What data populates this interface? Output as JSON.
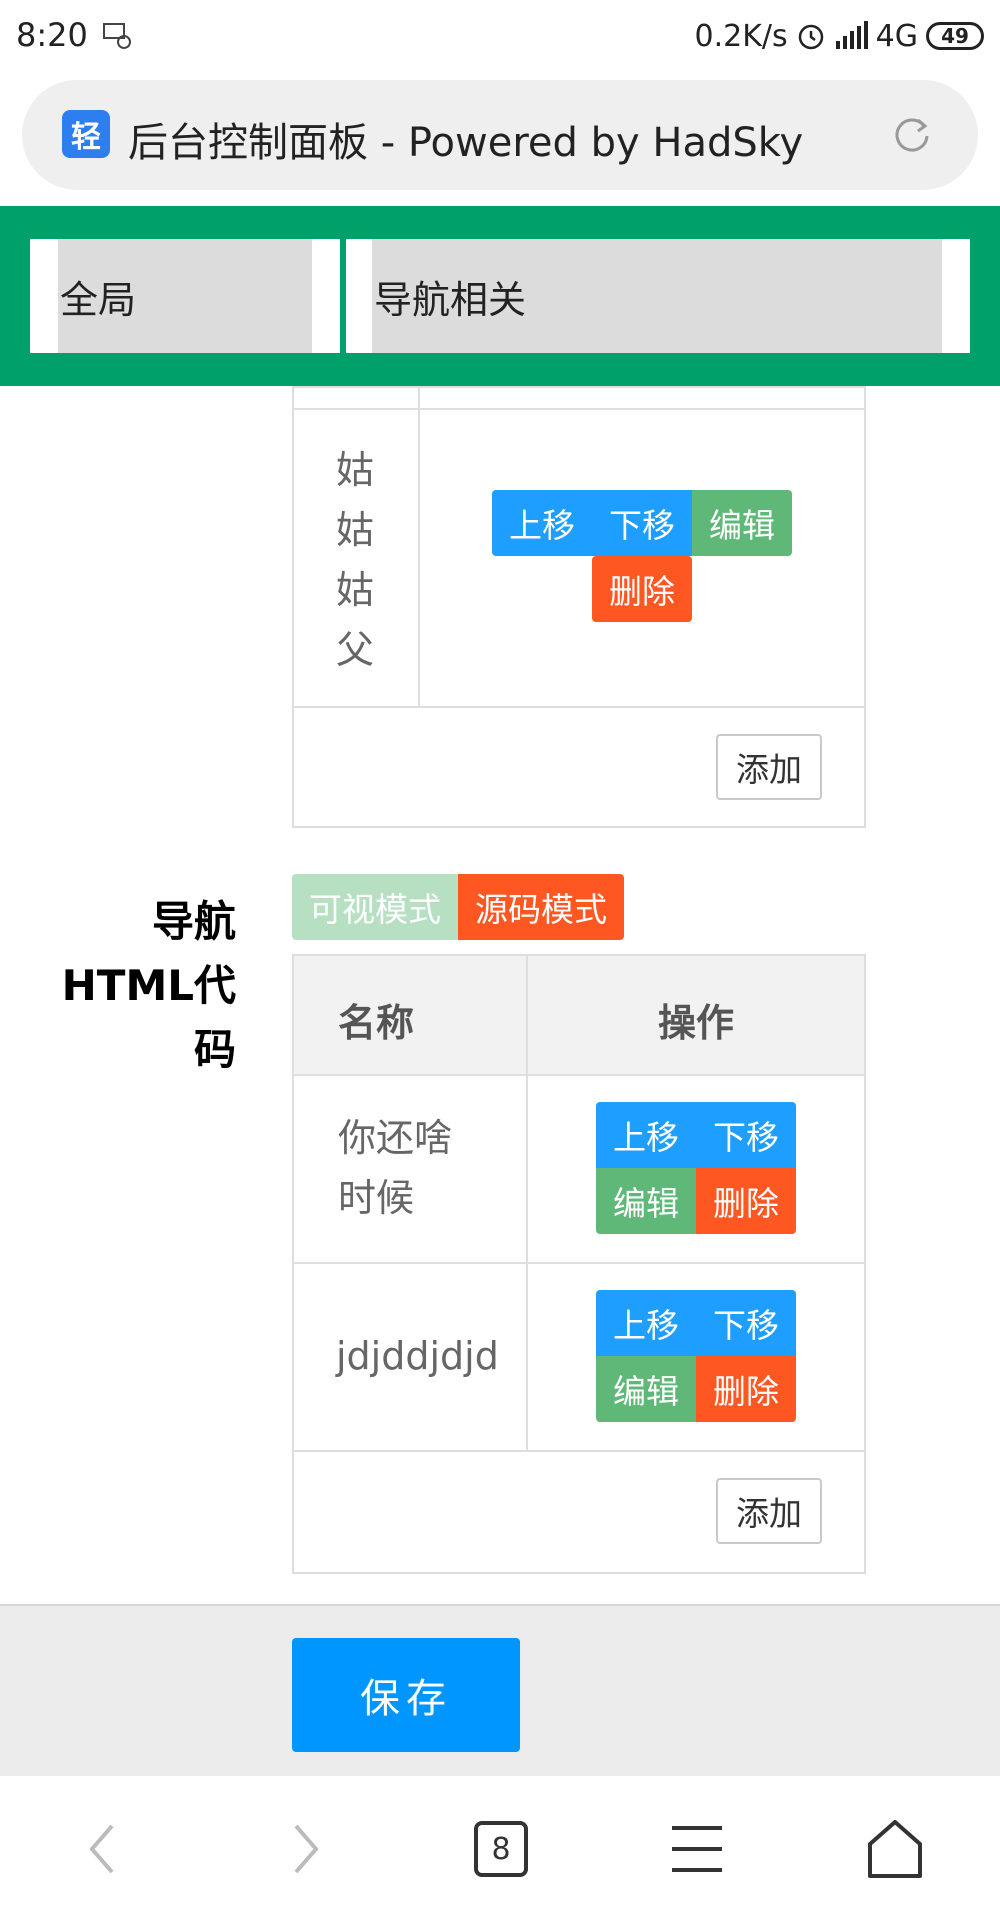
{
  "status_bar": {
    "time": "8:20",
    "net_speed": "0.2K/s",
    "network": "4G",
    "battery": "49"
  },
  "browser": {
    "site_icon_char": "轻",
    "page_title": "后台控制面板 - Powered by HadSky",
    "tab_count": "8"
  },
  "top_nav": {
    "items": [
      {
        "label": "全局"
      },
      {
        "label": "导航相关"
      }
    ]
  },
  "table1": {
    "row_name_chars": [
      "姑",
      "姑",
      "姑",
      "父"
    ],
    "buttons": {
      "up": "上移",
      "down": "下移",
      "edit": "编辑",
      "delete": "删除"
    },
    "add_label": "添加"
  },
  "section": {
    "label_lines": [
      "导航",
      "HTML代",
      "码"
    ],
    "mode_visual": "可视模式",
    "mode_source": "源码模式"
  },
  "table2": {
    "headers": [
      "名称",
      "操作"
    ],
    "rows": [
      {
        "name_lines": [
          "你还啥",
          "时候"
        ]
      },
      {
        "name_lines": [
          "jdjddjdjd"
        ]
      }
    ],
    "buttons": {
      "up": "上移",
      "down": "下移",
      "edit": "编辑",
      "delete": "删除"
    },
    "add_label": "添加"
  },
  "save_label": "保存",
  "colors": {
    "nav_green": "#00a06a",
    "btn_blue": "#1e9fff",
    "btn_green": "#5fb878",
    "btn_orange": "#ff5722",
    "save_blue": "#0096ff"
  }
}
